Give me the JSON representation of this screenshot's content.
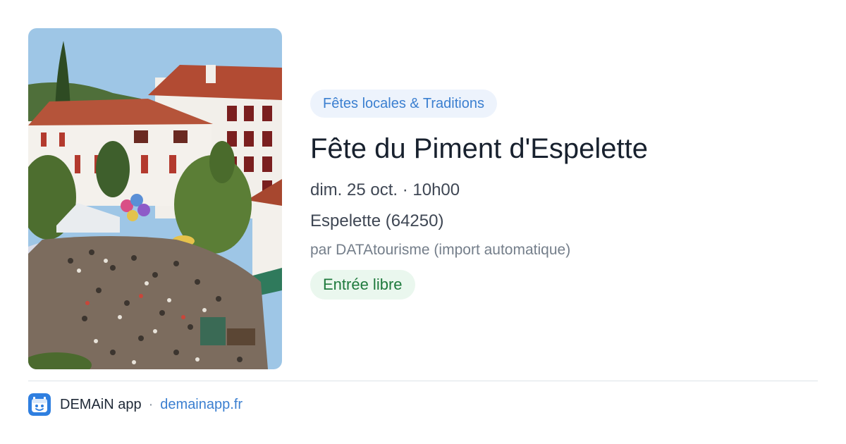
{
  "event": {
    "category": "Fêtes locales & Traditions",
    "title": "Fête du Piment d'Espelette",
    "datetime": "dim. 25 oct. · 10h00",
    "place": "Espelette (64250)",
    "organizer": "par DATAtourisme (import automatique)",
    "price": "Entrée libre"
  },
  "footer": {
    "app_name": "DEMAiN app",
    "separator": "·",
    "domain": "demainapp.fr"
  },
  "icons": {
    "app": "demain-app-logo-icon"
  },
  "colors": {
    "accent": "#3b7fd0",
    "category_bg": "#edf3fc",
    "price_text": "#1f7a3d",
    "price_bg": "#eaf7ee",
    "title": "#18212e"
  }
}
